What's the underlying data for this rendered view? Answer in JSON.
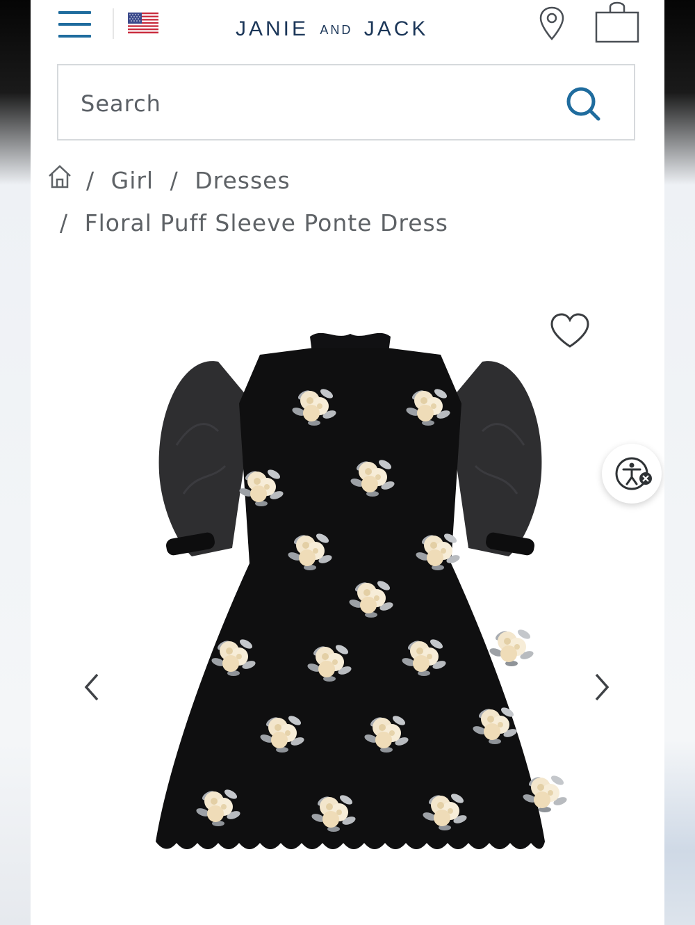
{
  "header": {
    "brand_main_1": "JANIE",
    "brand_small": "AND",
    "brand_main_2": "JACK",
    "icons": [
      "menu-icon",
      "us-flag-icon",
      "location-pin-icon",
      "shopping-bag-icon"
    ],
    "brand_color": "#1b3658",
    "accent_color": "#1f6c9e"
  },
  "search": {
    "placeholder": "Search",
    "value": ""
  },
  "breadcrumb": {
    "separator": "/",
    "items": [
      "Girl",
      "Dresses",
      "Floral Puff Sleeve Ponte Dress"
    ]
  },
  "product": {
    "icons": [
      "heart-icon",
      "chevron-left-icon",
      "chevron-right-icon",
      "accessibility-icon"
    ]
  }
}
